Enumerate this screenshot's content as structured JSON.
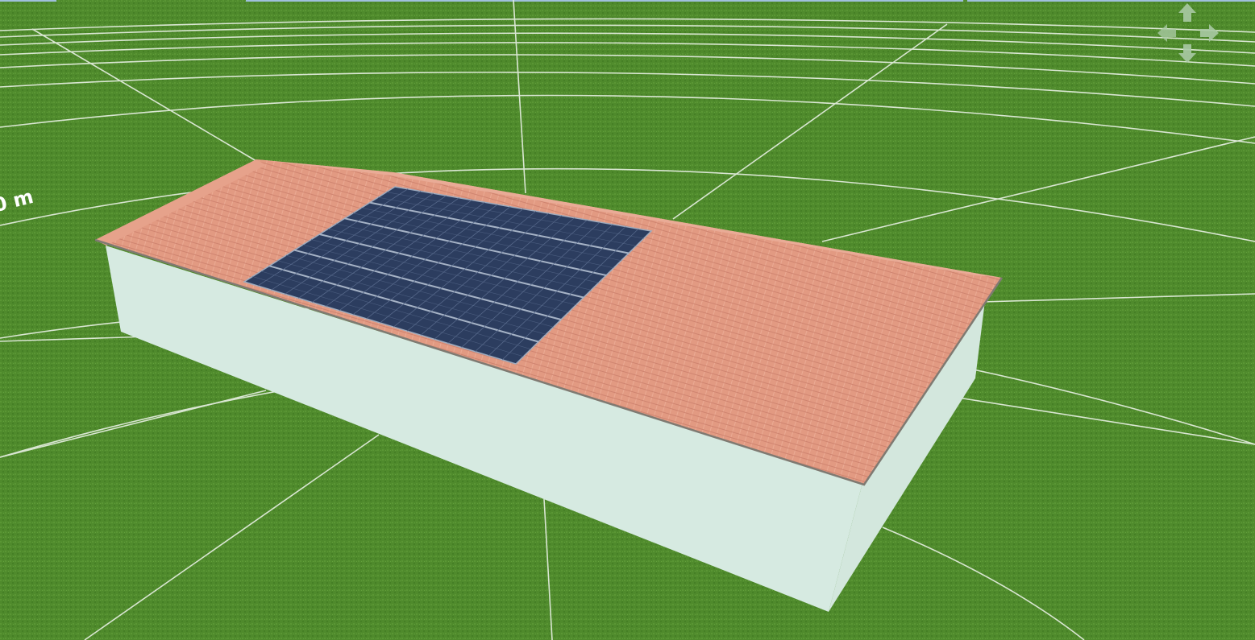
{
  "viewer": {
    "distance_label": "0 m"
  },
  "colors": {
    "grass": "#4f8a2c",
    "grass_dark": "#3f7a22",
    "grid": "#e8f0e4",
    "wall": "#d6eae1",
    "wall_shade": "#c6ddd3",
    "roof": "#e29a82",
    "roof_far": "#e7a590",
    "roof_edge": "#7f7a72",
    "panel": "#2c3d5f",
    "panel_line": "#a6b3c6",
    "nav": "#a9c9a4"
  },
  "nav_control": {
    "up_icon": "arrow-up-icon",
    "down_icon": "arrow-down-icon",
    "left_icon": "arrow-left-icon",
    "right_icon": "arrow-right-icon"
  },
  "solar_array": {
    "rows": 6,
    "columns": 20
  }
}
